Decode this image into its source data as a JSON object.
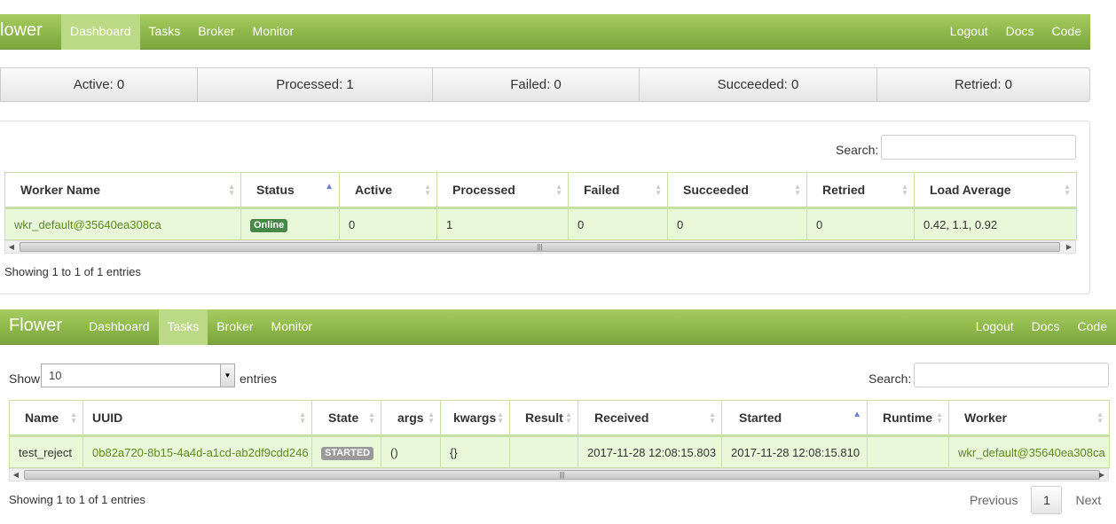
{
  "top_view": {
    "navbar": {
      "brand": "lower",
      "nav": [
        "Dashboard",
        "Tasks",
        "Broker",
        "Monitor"
      ],
      "active": "Dashboard",
      "right": [
        "Logout",
        "Docs",
        "Code"
      ]
    },
    "summary": {
      "active": "Active: 0",
      "processed": "Processed: 1",
      "failed": "Failed: 0",
      "succeeded": "Succeeded: 0",
      "retried": "Retried: 0"
    },
    "search_label": "Search:",
    "table": {
      "columns": [
        "Worker Name",
        "Status",
        "Active",
        "Processed",
        "Failed",
        "Succeeded",
        "Retried",
        "Load Average"
      ],
      "rows": [
        {
          "worker_name": "wkr_default@35640ea308ca",
          "status": "Online",
          "active": "0",
          "processed": "1",
          "failed": "0",
          "succeeded": "0",
          "retried": "0",
          "load_average": "0.42, 1.1, 0.92"
        }
      ]
    },
    "info": "Showing 1 to 1 of 1 entries"
  },
  "bottom_view": {
    "navbar": {
      "brand": "Flower",
      "nav": [
        "Dashboard",
        "Tasks",
        "Broker",
        "Monitor"
      ],
      "active": "Tasks",
      "right": [
        "Logout",
        "Docs",
        "Code"
      ]
    },
    "show_label": "Show",
    "length_value": "10",
    "entries_label": "entries",
    "search_label": "Search:",
    "table": {
      "columns": [
        "Name",
        "UUID",
        "State",
        "args",
        "kwargs",
        "Result",
        "Received",
        "Started",
        "Runtime",
        "Worker"
      ],
      "rows": [
        {
          "name": "test_reject",
          "uuid": "0b82a720-8b15-4a4d-a1cd-ab2df9cdd246",
          "state": "STARTED",
          "args": "()",
          "kwargs": "{}",
          "result": "",
          "received": "2017-11-28 12:08:15.803",
          "started": "2017-11-28 12:08:15.810",
          "runtime": "",
          "worker": "wkr_default@35640ea308ca"
        }
      ]
    },
    "info": "Showing 1 to 1 of 1 entries",
    "pagination": {
      "previous": "Previous",
      "current": "1",
      "next": "Next"
    }
  },
  "colors": {
    "navbar_top": "#a6cc5e",
    "navbar_bottom": "#7aa63c",
    "nav_active": "#bcd986",
    "row_bg": "#eaf8da",
    "link": "#5e8a1c",
    "online_badge": "#468847",
    "started_badge": "#999999"
  },
  "icons": {
    "sort_neutral": "sort-both-icon",
    "sort_ascending": "sort-asc-icon",
    "scroll_left": "arrow-left-icon",
    "scroll_right": "arrow-right-icon",
    "select_dropdown": "chevron-down-icon"
  }
}
